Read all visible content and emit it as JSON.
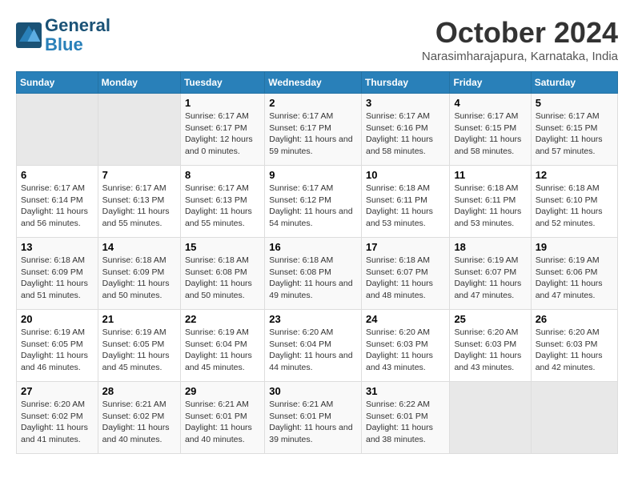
{
  "header": {
    "logo_line1": "General",
    "logo_line2": "Blue",
    "month": "October 2024",
    "location": "Narasimharajapura, Karnataka, India"
  },
  "weekdays": [
    "Sunday",
    "Monday",
    "Tuesday",
    "Wednesday",
    "Thursday",
    "Friday",
    "Saturday"
  ],
  "weeks": [
    [
      {
        "day": "",
        "content": ""
      },
      {
        "day": "",
        "content": ""
      },
      {
        "day": "1",
        "content": "Sunrise: 6:17 AM\nSunset: 6:17 PM\nDaylight: 12 hours\nand 0 minutes."
      },
      {
        "day": "2",
        "content": "Sunrise: 6:17 AM\nSunset: 6:17 PM\nDaylight: 11 hours\nand 59 minutes."
      },
      {
        "day": "3",
        "content": "Sunrise: 6:17 AM\nSunset: 6:16 PM\nDaylight: 11 hours\nand 58 minutes."
      },
      {
        "day": "4",
        "content": "Sunrise: 6:17 AM\nSunset: 6:15 PM\nDaylight: 11 hours\nand 58 minutes."
      },
      {
        "day": "5",
        "content": "Sunrise: 6:17 AM\nSunset: 6:15 PM\nDaylight: 11 hours\nand 57 minutes."
      }
    ],
    [
      {
        "day": "6",
        "content": "Sunrise: 6:17 AM\nSunset: 6:14 PM\nDaylight: 11 hours\nand 56 minutes."
      },
      {
        "day": "7",
        "content": "Sunrise: 6:17 AM\nSunset: 6:13 PM\nDaylight: 11 hours\nand 55 minutes."
      },
      {
        "day": "8",
        "content": "Sunrise: 6:17 AM\nSunset: 6:13 PM\nDaylight: 11 hours\nand 55 minutes."
      },
      {
        "day": "9",
        "content": "Sunrise: 6:17 AM\nSunset: 6:12 PM\nDaylight: 11 hours\nand 54 minutes."
      },
      {
        "day": "10",
        "content": "Sunrise: 6:18 AM\nSunset: 6:11 PM\nDaylight: 11 hours\nand 53 minutes."
      },
      {
        "day": "11",
        "content": "Sunrise: 6:18 AM\nSunset: 6:11 PM\nDaylight: 11 hours\nand 53 minutes."
      },
      {
        "day": "12",
        "content": "Sunrise: 6:18 AM\nSunset: 6:10 PM\nDaylight: 11 hours\nand 52 minutes."
      }
    ],
    [
      {
        "day": "13",
        "content": "Sunrise: 6:18 AM\nSunset: 6:09 PM\nDaylight: 11 hours\nand 51 minutes."
      },
      {
        "day": "14",
        "content": "Sunrise: 6:18 AM\nSunset: 6:09 PM\nDaylight: 11 hours\nand 50 minutes."
      },
      {
        "day": "15",
        "content": "Sunrise: 6:18 AM\nSunset: 6:08 PM\nDaylight: 11 hours\nand 50 minutes."
      },
      {
        "day": "16",
        "content": "Sunrise: 6:18 AM\nSunset: 6:08 PM\nDaylight: 11 hours\nand 49 minutes."
      },
      {
        "day": "17",
        "content": "Sunrise: 6:18 AM\nSunset: 6:07 PM\nDaylight: 11 hours\nand 48 minutes."
      },
      {
        "day": "18",
        "content": "Sunrise: 6:19 AM\nSunset: 6:07 PM\nDaylight: 11 hours\nand 47 minutes."
      },
      {
        "day": "19",
        "content": "Sunrise: 6:19 AM\nSunset: 6:06 PM\nDaylight: 11 hours\nand 47 minutes."
      }
    ],
    [
      {
        "day": "20",
        "content": "Sunrise: 6:19 AM\nSunset: 6:05 PM\nDaylight: 11 hours\nand 46 minutes."
      },
      {
        "day": "21",
        "content": "Sunrise: 6:19 AM\nSunset: 6:05 PM\nDaylight: 11 hours\nand 45 minutes."
      },
      {
        "day": "22",
        "content": "Sunrise: 6:19 AM\nSunset: 6:04 PM\nDaylight: 11 hours\nand 45 minutes."
      },
      {
        "day": "23",
        "content": "Sunrise: 6:20 AM\nSunset: 6:04 PM\nDaylight: 11 hours\nand 44 minutes."
      },
      {
        "day": "24",
        "content": "Sunrise: 6:20 AM\nSunset: 6:03 PM\nDaylight: 11 hours\nand 43 minutes."
      },
      {
        "day": "25",
        "content": "Sunrise: 6:20 AM\nSunset: 6:03 PM\nDaylight: 11 hours\nand 43 minutes."
      },
      {
        "day": "26",
        "content": "Sunrise: 6:20 AM\nSunset: 6:03 PM\nDaylight: 11 hours\nand 42 minutes."
      }
    ],
    [
      {
        "day": "27",
        "content": "Sunrise: 6:20 AM\nSunset: 6:02 PM\nDaylight: 11 hours\nand 41 minutes."
      },
      {
        "day": "28",
        "content": "Sunrise: 6:21 AM\nSunset: 6:02 PM\nDaylight: 11 hours\nand 40 minutes."
      },
      {
        "day": "29",
        "content": "Sunrise: 6:21 AM\nSunset: 6:01 PM\nDaylight: 11 hours\nand 40 minutes."
      },
      {
        "day": "30",
        "content": "Sunrise: 6:21 AM\nSunset: 6:01 PM\nDaylight: 11 hours\nand 39 minutes."
      },
      {
        "day": "31",
        "content": "Sunrise: 6:22 AM\nSunset: 6:01 PM\nDaylight: 11 hours\nand 38 minutes."
      },
      {
        "day": "",
        "content": ""
      },
      {
        "day": "",
        "content": ""
      }
    ]
  ]
}
